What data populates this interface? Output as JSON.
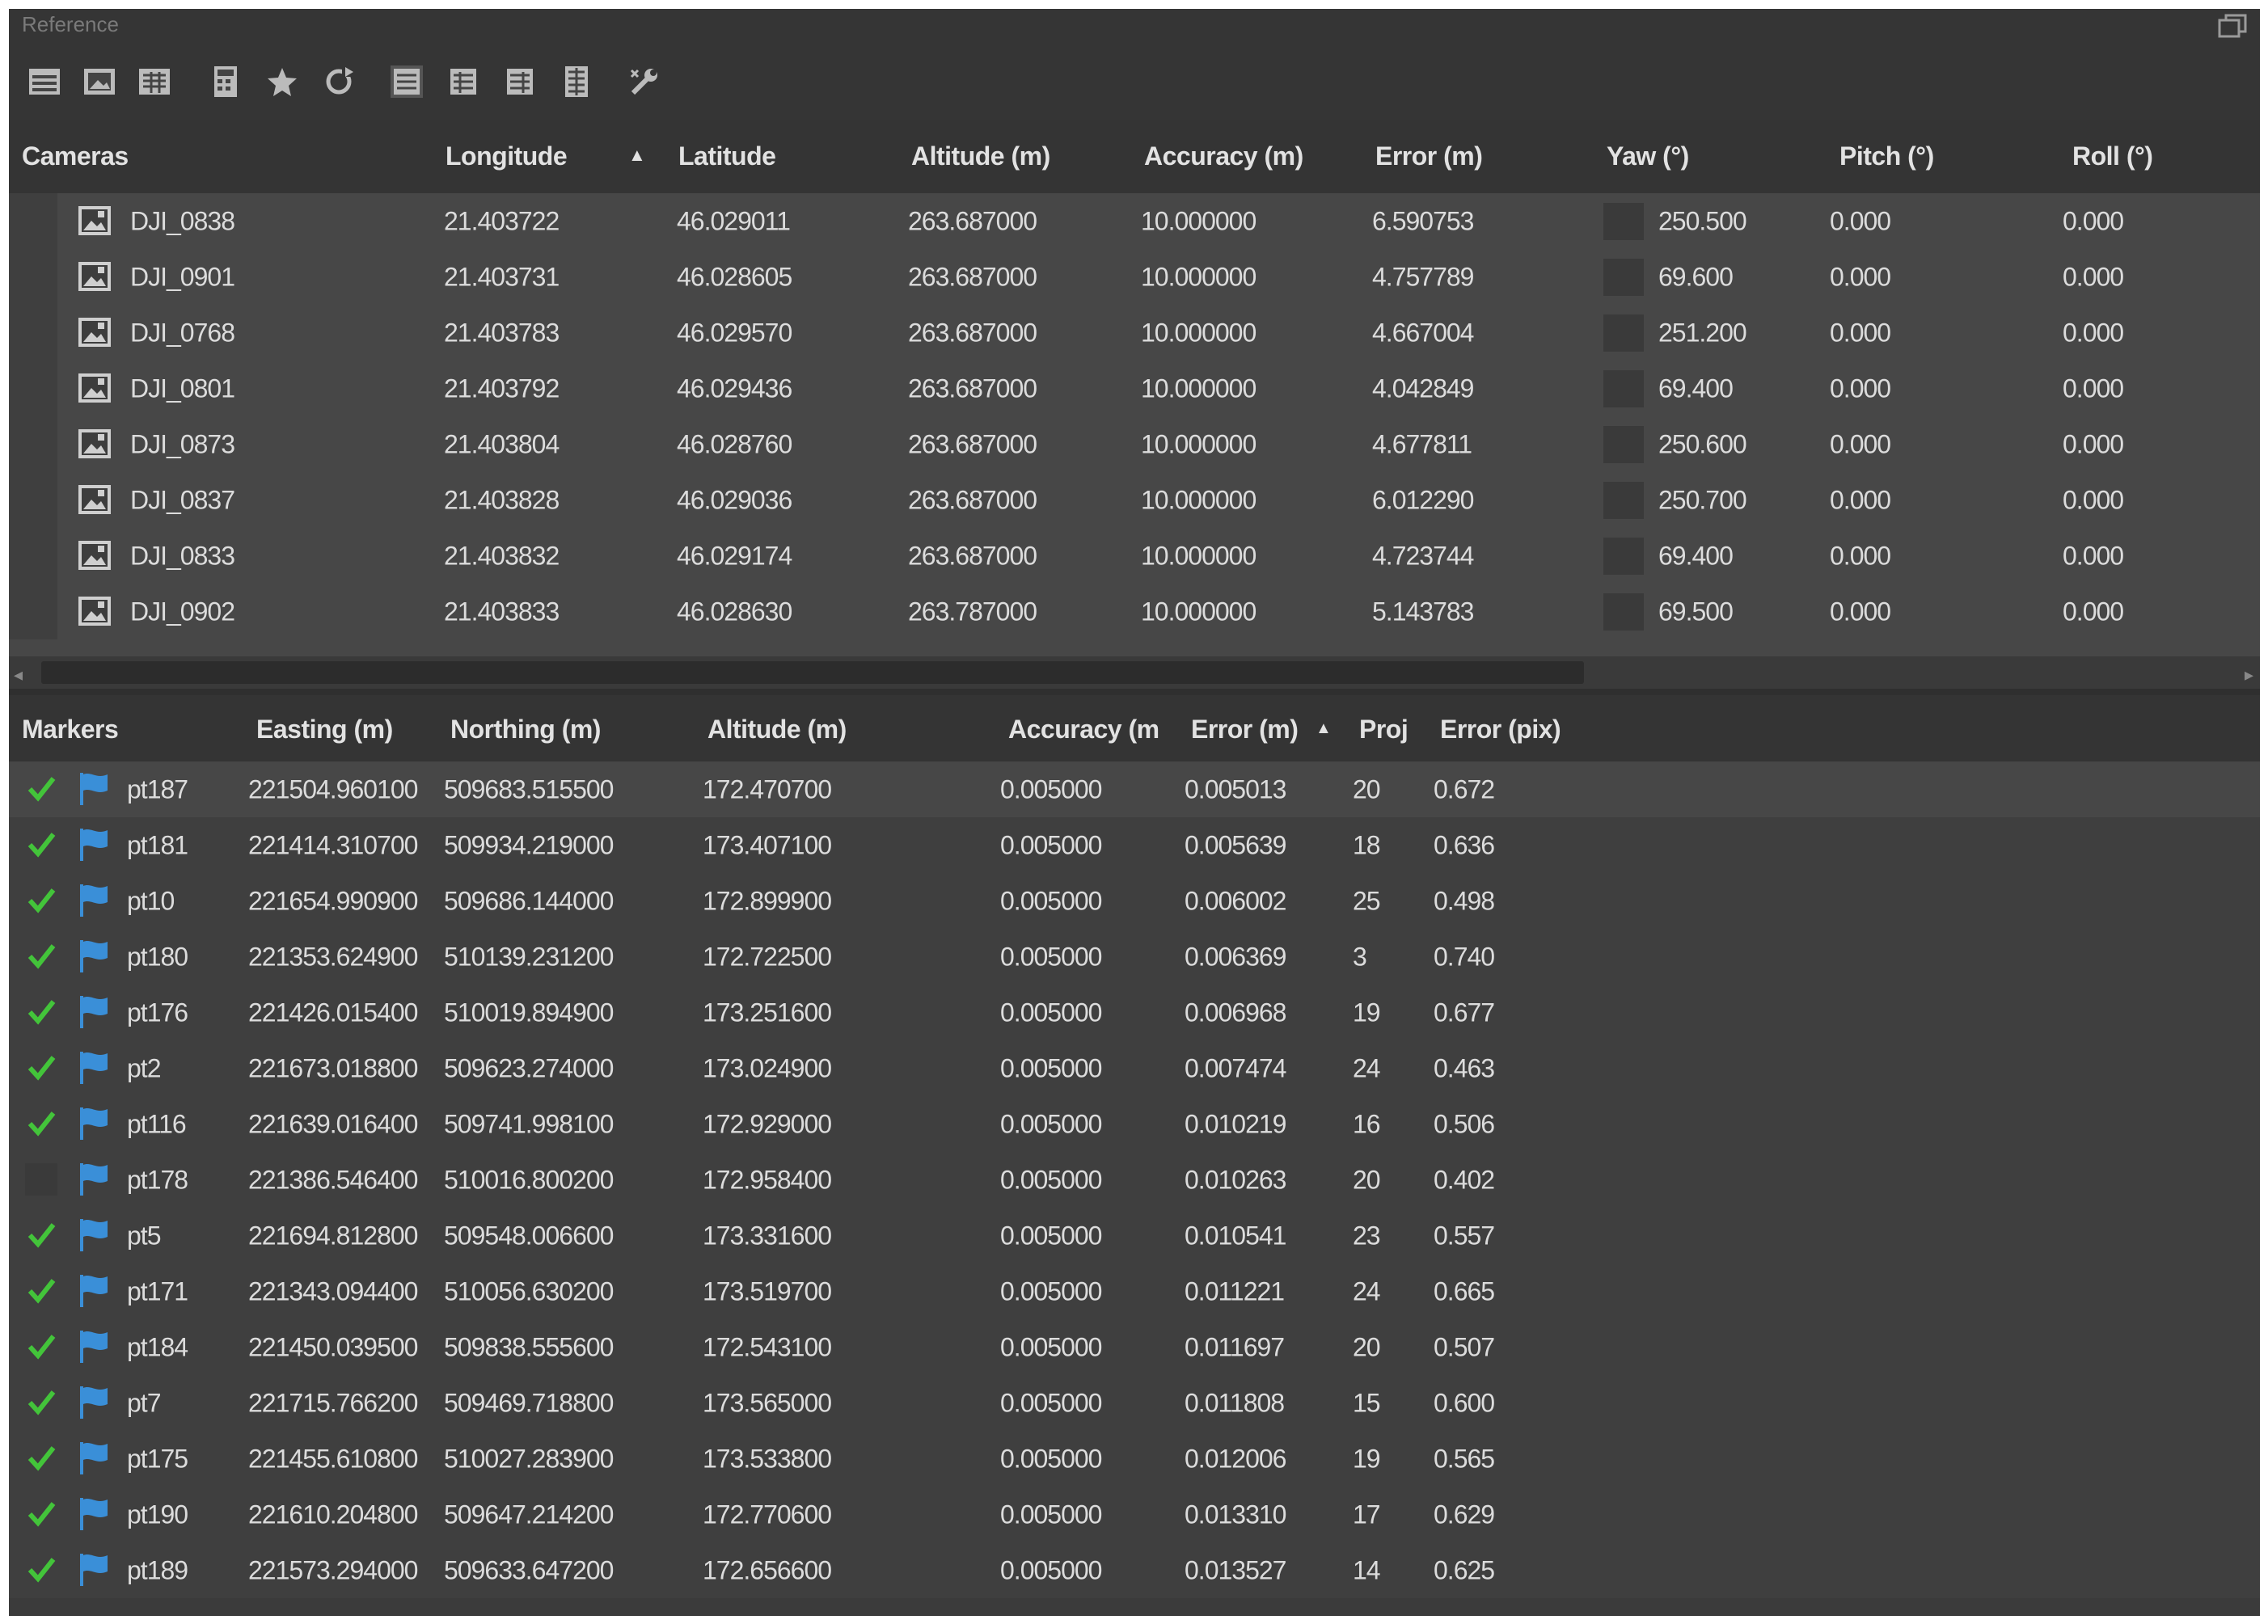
{
  "window": {
    "title": "Reference"
  },
  "toolbar": {
    "icons": [
      "table-view-icon",
      "image-view-icon",
      "details-view-icon",
      "calculator-icon",
      "star-icon",
      "refresh-icon",
      "cameras-layout-icon",
      "markers-layout-icon",
      "scalebars-layout-icon",
      "columns-layout-icon",
      "settings-tool-icon"
    ]
  },
  "cameras": {
    "headers": {
      "name": "Cameras",
      "longitude": "Longitude",
      "sort_indicator": "▲",
      "latitude": "Latitude",
      "altitude": "Altitude (m)",
      "accuracy": "Accuracy (m)",
      "error": "Error (m)",
      "yaw": "Yaw (°)",
      "pitch": "Pitch (°)",
      "roll": "Roll (°)"
    },
    "rows": [
      {
        "name": "DJI_0838",
        "longitude": "21.403722",
        "latitude": "46.029011",
        "altitude": "263.687000",
        "accuracy": "10.000000",
        "error": "6.590753",
        "yaw": "250.500",
        "pitch": "0.000",
        "roll": "0.000"
      },
      {
        "name": "DJI_0901",
        "longitude": "21.403731",
        "latitude": "46.028605",
        "altitude": "263.687000",
        "accuracy": "10.000000",
        "error": "4.757789",
        "yaw": "69.600",
        "pitch": "0.000",
        "roll": "0.000"
      },
      {
        "name": "DJI_0768",
        "longitude": "21.403783",
        "latitude": "46.029570",
        "altitude": "263.687000",
        "accuracy": "10.000000",
        "error": "4.667004",
        "yaw": "251.200",
        "pitch": "0.000",
        "roll": "0.000"
      },
      {
        "name": "DJI_0801",
        "longitude": "21.403792",
        "latitude": "46.029436",
        "altitude": "263.687000",
        "accuracy": "10.000000",
        "error": "4.042849",
        "yaw": "69.400",
        "pitch": "0.000",
        "roll": "0.000"
      },
      {
        "name": "DJI_0873",
        "longitude": "21.403804",
        "latitude": "46.028760",
        "altitude": "263.687000",
        "accuracy": "10.000000",
        "error": "4.677811",
        "yaw": "250.600",
        "pitch": "0.000",
        "roll": "0.000"
      },
      {
        "name": "DJI_0837",
        "longitude": "21.403828",
        "latitude": "46.029036",
        "altitude": "263.687000",
        "accuracy": "10.000000",
        "error": "6.012290",
        "yaw": "250.700",
        "pitch": "0.000",
        "roll": "0.000"
      },
      {
        "name": "DJI_0833",
        "longitude": "21.403832",
        "latitude": "46.029174",
        "altitude": "263.687000",
        "accuracy": "10.000000",
        "error": "4.723744",
        "yaw": "69.400",
        "pitch": "0.000",
        "roll": "0.000"
      },
      {
        "name": "DJI_0902",
        "longitude": "21.403833",
        "latitude": "46.028630",
        "altitude": "263.787000",
        "accuracy": "10.000000",
        "error": "5.143783",
        "yaw": "69.500",
        "pitch": "0.000",
        "roll": "0.000"
      }
    ]
  },
  "markers": {
    "headers": {
      "name": "Markers",
      "easting": "Easting (m)",
      "northing": "Northing (m)",
      "altitude": "Altitude (m)",
      "accuracy": "Accuracy (m",
      "error": "Error (m)",
      "sort_indicator": "▲",
      "proj": "Proj",
      "error_pix": "Error (pix)"
    },
    "rows": [
      {
        "checked": true,
        "name": "pt187",
        "easting": "221504.960100",
        "northing": "509683.515500",
        "altitude": "172.470700",
        "accuracy": "0.005000",
        "error": "0.005013",
        "proj": "20",
        "error_pix": "0.672"
      },
      {
        "checked": true,
        "name": "pt181",
        "easting": "221414.310700",
        "northing": "509934.219000",
        "altitude": "173.407100",
        "accuracy": "0.005000",
        "error": "0.005639",
        "proj": "18",
        "error_pix": "0.636"
      },
      {
        "checked": true,
        "name": "pt10",
        "easting": "221654.990900",
        "northing": "509686.144000",
        "altitude": "172.899900",
        "accuracy": "0.005000",
        "error": "0.006002",
        "proj": "25",
        "error_pix": "0.498"
      },
      {
        "checked": true,
        "name": "pt180",
        "easting": "221353.624900",
        "northing": "510139.231200",
        "altitude": "172.722500",
        "accuracy": "0.005000",
        "error": "0.006369",
        "proj": "3",
        "error_pix": "0.740"
      },
      {
        "checked": true,
        "name": "pt176",
        "easting": "221426.015400",
        "northing": "510019.894900",
        "altitude": "173.251600",
        "accuracy": "0.005000",
        "error": "0.006968",
        "proj": "19",
        "error_pix": "0.677"
      },
      {
        "checked": true,
        "name": "pt2",
        "easting": "221673.018800",
        "northing": "509623.274000",
        "altitude": "173.024900",
        "accuracy": "0.005000",
        "error": "0.007474",
        "proj": "24",
        "error_pix": "0.463"
      },
      {
        "checked": true,
        "name": "pt116",
        "easting": "221639.016400",
        "northing": "509741.998100",
        "altitude": "172.929000",
        "accuracy": "0.005000",
        "error": "0.010219",
        "proj": "16",
        "error_pix": "0.506"
      },
      {
        "checked": false,
        "name": "pt178",
        "easting": "221386.546400",
        "northing": "510016.800200",
        "altitude": "172.958400",
        "accuracy": "0.005000",
        "error": "0.010263",
        "proj": "20",
        "error_pix": "0.402"
      },
      {
        "checked": true,
        "name": "pt5",
        "easting": "221694.812800",
        "northing": "509548.006600",
        "altitude": "173.331600",
        "accuracy": "0.005000",
        "error": "0.010541",
        "proj": "23",
        "error_pix": "0.557"
      },
      {
        "checked": true,
        "name": "pt171",
        "easting": "221343.094400",
        "northing": "510056.630200",
        "altitude": "173.519700",
        "accuracy": "0.005000",
        "error": "0.011221",
        "proj": "24",
        "error_pix": "0.665"
      },
      {
        "checked": true,
        "name": "pt184",
        "easting": "221450.039500",
        "northing": "509838.555600",
        "altitude": "172.543100",
        "accuracy": "0.005000",
        "error": "0.011697",
        "proj": "20",
        "error_pix": "0.507"
      },
      {
        "checked": true,
        "name": "pt7",
        "easting": "221715.766200",
        "northing": "509469.718800",
        "altitude": "173.565000",
        "accuracy": "0.005000",
        "error": "0.011808",
        "proj": "15",
        "error_pix": "0.600"
      },
      {
        "checked": true,
        "name": "pt175",
        "easting": "221455.610800",
        "northing": "510027.283900",
        "altitude": "173.533800",
        "accuracy": "0.005000",
        "error": "0.012006",
        "proj": "19",
        "error_pix": "0.565"
      },
      {
        "checked": true,
        "name": "pt190",
        "easting": "221610.204800",
        "northing": "509647.214200",
        "altitude": "172.770600",
        "accuracy": "0.005000",
        "error": "0.013310",
        "proj": "17",
        "error_pix": "0.629"
      },
      {
        "checked": true,
        "name": "pt189",
        "easting": "221573.294000",
        "northing": "509633.647200",
        "altitude": "172.656600",
        "accuracy": "0.005000",
        "error": "0.013527",
        "proj": "14",
        "error_pix": "0.625"
      }
    ]
  },
  "colors": {
    "background": "#3b3b3b",
    "header": "#343434",
    "camera_row": "#474747",
    "marker_row": "#3f3f3f",
    "check": "#43c43a",
    "flag": "#3a8fd8"
  }
}
